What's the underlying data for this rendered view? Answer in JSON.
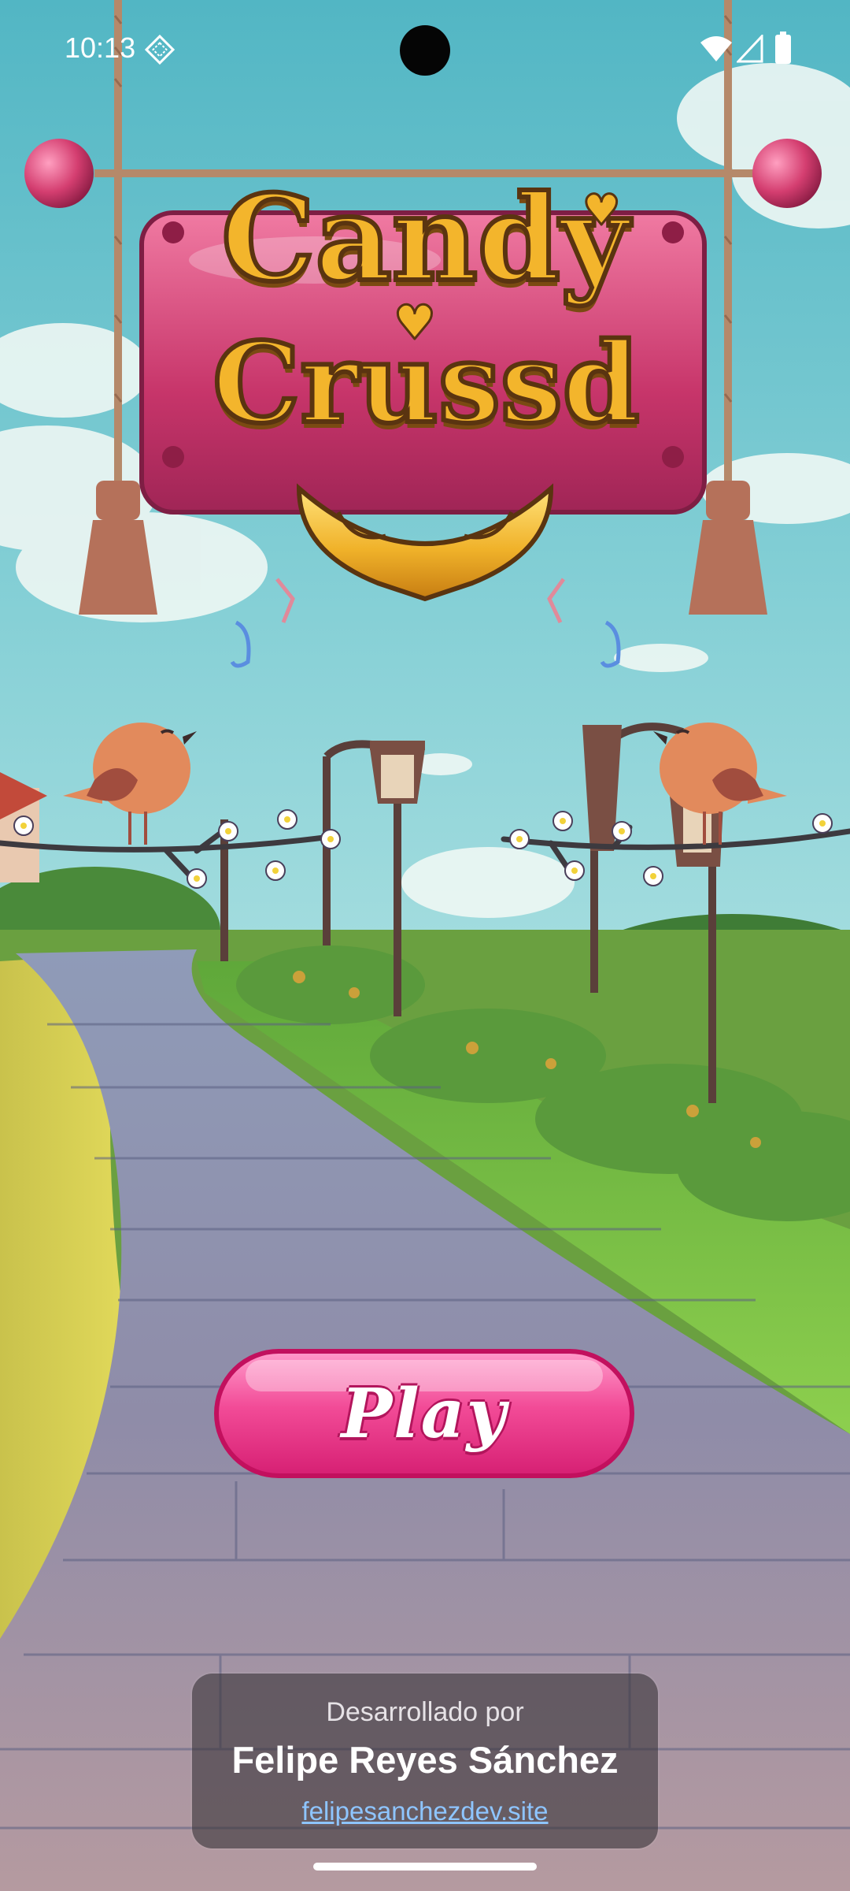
{
  "status_bar": {
    "time": "10:13",
    "icons": [
      "app-notification-icon",
      "wifi-icon",
      "signal-icon",
      "battery-icon"
    ]
  },
  "logo": {
    "line1": "Candy",
    "line2": "Crussd"
  },
  "play_button": {
    "label": "Play",
    "color": "#ee3f8f"
  },
  "credits": {
    "developed_by": "Desarrollado por",
    "author": "Felipe Reyes Sánchez",
    "website": "felipesanchezdev.site"
  },
  "colors": {
    "sky": "#6fc6cf",
    "sign_pink": "#d9457a",
    "logo_gold": "#f1b52a",
    "path_stone": "#8f93ad",
    "grass": "#7fbc42"
  }
}
